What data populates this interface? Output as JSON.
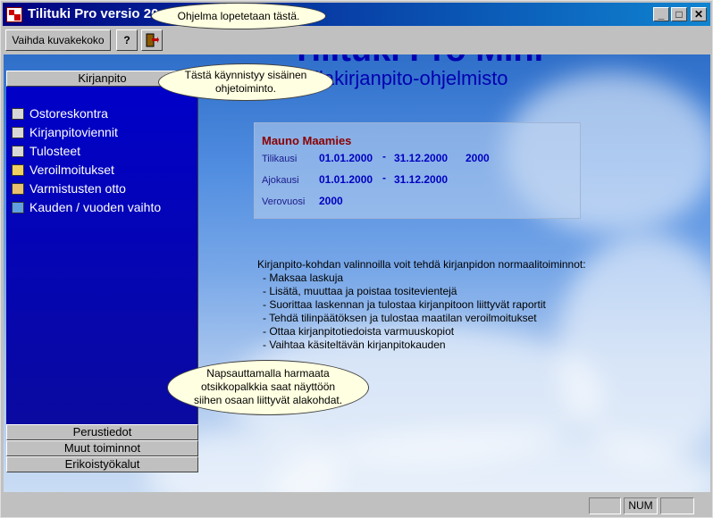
{
  "window": {
    "title": "Tilituki Pro versio 20",
    "minimize": "_",
    "maximize": "□",
    "close": "✕"
  },
  "toolbar": {
    "change_size": "Vaihda kuvakekoko",
    "help": "?",
    "exit_icon": "exit-door-icon",
    "help_icon": "question-icon"
  },
  "brand": {
    "title": "Tilituki Pro Mini",
    "subtitle": "tilakirjanpito-ohjelmisto"
  },
  "sidebar": {
    "header": "Kirjanpito",
    "items": [
      {
        "label": "Ostoreskontra",
        "icon": "ledger-icon"
      },
      {
        "label": "Kirjanpitoviennit",
        "icon": "ledger-icon"
      },
      {
        "label": "Tulosteet",
        "icon": "printer-icon"
      },
      {
        "label": "Veroilmoitukset",
        "icon": "folder-icon"
      },
      {
        "label": "Varmistusten otto",
        "icon": "backup-icon"
      },
      {
        "label": "Kauden / vuoden vaihto",
        "icon": "calendar-icon"
      }
    ],
    "groups": [
      "Perustiedot",
      "Muut toiminnot",
      "Erikoistyökalut"
    ]
  },
  "info": {
    "name": "Mauno Maamies",
    "tilikausi_label": "Tilikausi",
    "tilikausi_start": "01.01.2000",
    "tilikausi_end": "31.12.2000",
    "tilikausi_year": "2000",
    "ajokausi_label": "Ajokausi",
    "ajokausi_start": "01.01.2000",
    "ajokausi_end": "31.12.2000",
    "verovuosi_label": "Verovuosi",
    "verovuosi": "2000",
    "dash": "-"
  },
  "description": {
    "intro": "Kirjanpito-kohdan valinnoilla voit tehdä kirjanpidon normaalitoiminnot:",
    "items": [
      "- Maksaa laskuja",
      "- Lisätä, muuttaa ja poistaa tositevientejä",
      "- Suorittaa laskennan ja tulostaa kirjanpitoon liittyvät raportit",
      "- Tehdä tilinpäätöksen ja tulostaa maatilan veroilmoitukset",
      "- Ottaa kirjanpitotiedoista varmuuskopiot",
      "- Vaihtaa käsiteltävän kirjanpitokauden"
    ]
  },
  "callouts": {
    "exit": "Ohjelma lopetetaan tästä.",
    "help": "Tästä käynnistyy sisäinen ohjetoiminto.",
    "groups": "Napsauttamalla harmaata otsikkopalkkia saat näyttöön siihen osaan liittyvät alakohdat."
  },
  "status": {
    "num": "NUM"
  }
}
